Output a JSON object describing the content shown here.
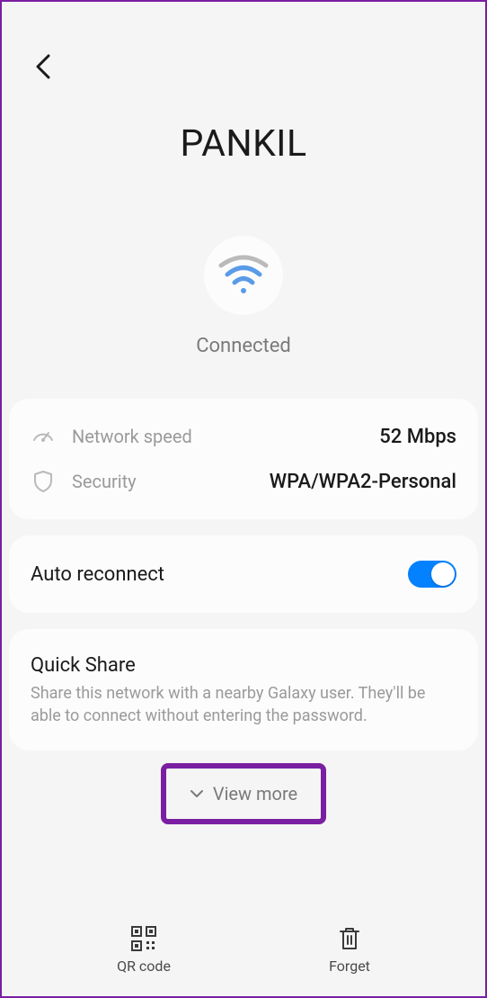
{
  "header": {
    "network_name": "PANKIL"
  },
  "status": {
    "connected": "Connected"
  },
  "details": {
    "speed_label": "Network speed",
    "speed_value": "52 Mbps",
    "security_label": "Security",
    "security_value": "WPA/WPA2-Personal"
  },
  "auto_reconnect": {
    "label": "Auto reconnect",
    "enabled": true
  },
  "quick_share": {
    "title": "Quick Share",
    "description": "Share this network with a nearby Galaxy user. They'll be able to connect without entering the password."
  },
  "view_more": {
    "label": "View more"
  },
  "bottom_bar": {
    "qr_label": "QR code",
    "forget_label": "Forget"
  }
}
